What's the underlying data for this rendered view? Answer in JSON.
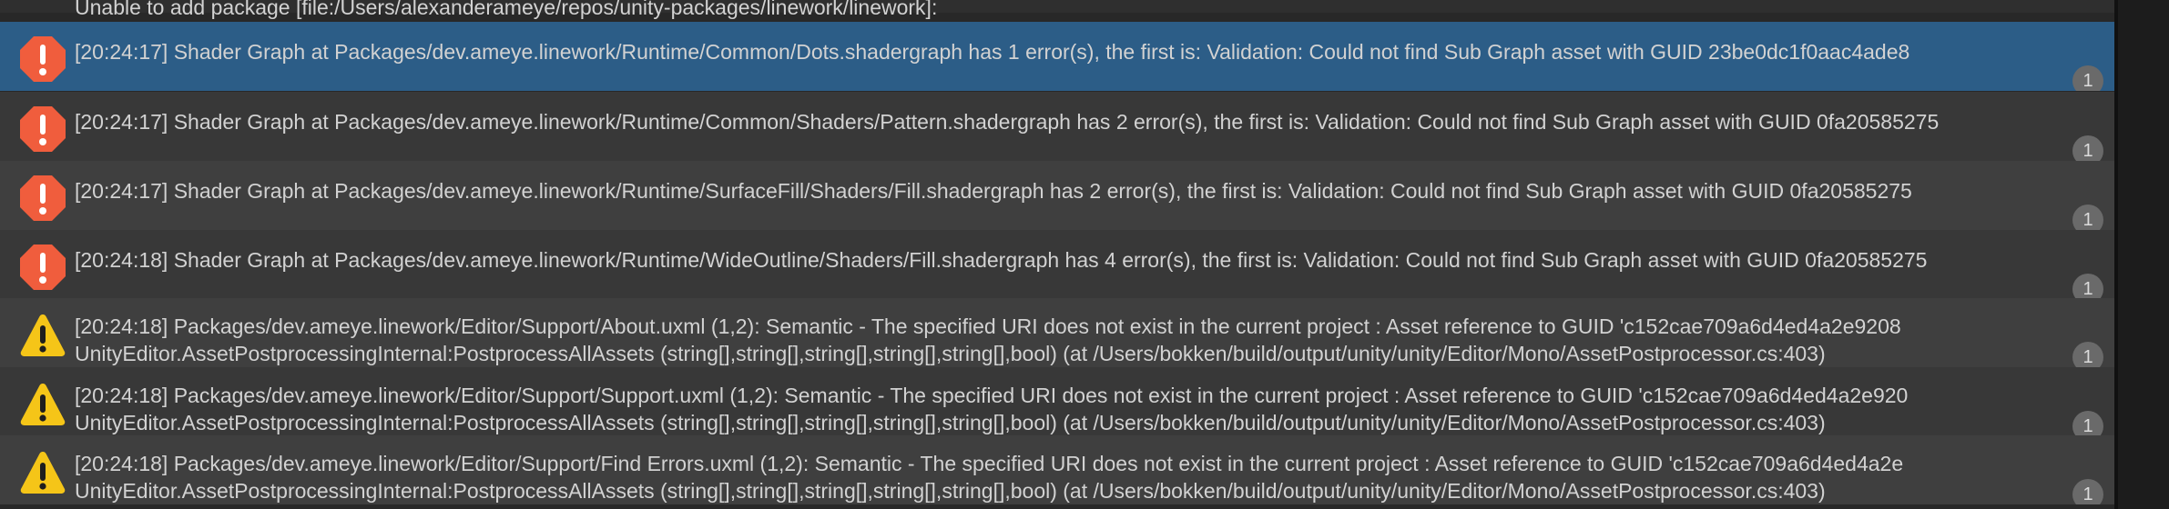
{
  "console": {
    "partial_message": "Unable to add package [file:/Users/alexanderameye/repos/unity-packages/linework/linework]:",
    "rows": [
      {
        "type": "error",
        "state": "selected",
        "icon": "error-icon",
        "lines": [
          "[20:24:17] Shader Graph at Packages/dev.ameye.linework/Runtime/Common/Dots.shadergraph has 1 error(s), the first is: Validation: Could not find Sub Graph asset with GUID 23be0dc1f0aac4ade8"
        ],
        "count": "1"
      },
      {
        "type": "error",
        "state": "dark",
        "icon": "error-icon",
        "lines": [
          "[20:24:17] Shader Graph at Packages/dev.ameye.linework/Runtime/Common/Shaders/Pattern.shadergraph has 2 error(s), the first is: Validation: Could not find Sub Graph asset with GUID 0fa20585275"
        ],
        "count": "1"
      },
      {
        "type": "error",
        "state": "light",
        "icon": "error-icon",
        "lines": [
          "[20:24:17] Shader Graph at Packages/dev.ameye.linework/Runtime/SurfaceFill/Shaders/Fill.shadergraph has 2 error(s), the first is: Validation: Could not find Sub Graph asset with GUID 0fa20585275"
        ],
        "count": "1"
      },
      {
        "type": "error",
        "state": "dark",
        "icon": "error-icon",
        "lines": [
          "[20:24:18] Shader Graph at Packages/dev.ameye.linework/Runtime/WideOutline/Shaders/Fill.shadergraph has 4 error(s), the first is: Validation: Could not find Sub Graph asset with GUID 0fa20585275"
        ],
        "count": "1"
      },
      {
        "type": "warning",
        "state": "light",
        "icon": "warning-icon",
        "lines": [
          "[20:24:18] Packages/dev.ameye.linework/Editor/Support/About.uxml (1,2): Semantic - The specified URI does not exist in the current project : Asset reference to GUID 'c152cae709a6d4ed4a2e9208",
          "UnityEditor.AssetPostprocessingInternal:PostprocessAllAssets (string[],string[],string[],string[],string[],bool) (at /Users/bokken/build/output/unity/unity/Editor/Mono/AssetPostprocessor.cs:403)"
        ],
        "count": "1"
      },
      {
        "type": "warning",
        "state": "dark",
        "icon": "warning-icon",
        "lines": [
          "[20:24:18] Packages/dev.ameye.linework/Editor/Support/Support.uxml (1,2): Semantic - The specified URI does not exist in the current project : Asset reference to GUID 'c152cae709a6d4ed4a2e920",
          "UnityEditor.AssetPostprocessingInternal:PostprocessAllAssets (string[],string[],string[],string[],string[],bool) (at /Users/bokken/build/output/unity/unity/Editor/Mono/AssetPostprocessor.cs:403)"
        ],
        "count": "1"
      },
      {
        "type": "warning",
        "state": "light",
        "icon": "warning-icon",
        "lines": [
          "[20:24:18] Packages/dev.ameye.linework/Editor/Support/Find Errors.uxml (1,2): Semantic - The specified URI does not exist in the current project : Asset reference to GUID 'c152cae709a6d4ed4a2e",
          "UnityEditor.AssetPostprocessingInternal:PostprocessAllAssets (string[],string[],string[],string[],string[],bool) (at /Users/bokken/build/output/unity/unity/Editor/Mono/AssetPostprocessor.cs:403)"
        ],
        "count": "1"
      }
    ]
  },
  "colors": {
    "error_red": "#f05d3d",
    "warning_yellow": "#f5c518",
    "selected_row": "#2c5d87",
    "row_dark": "#383838",
    "row_light": "#3f3f3f"
  }
}
